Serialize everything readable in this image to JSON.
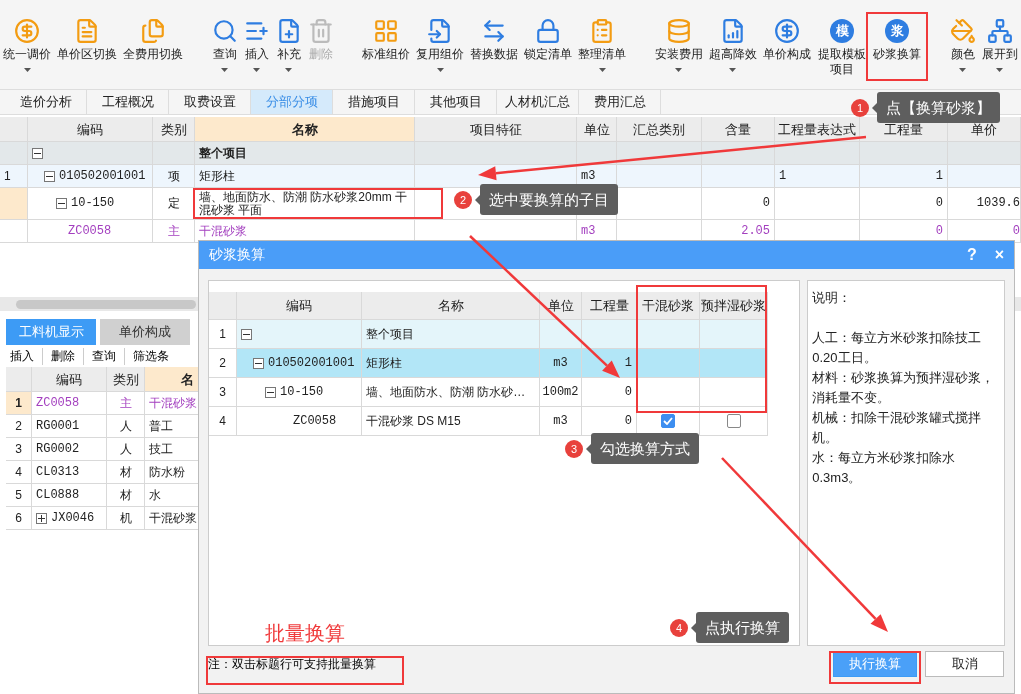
{
  "toolbar": {
    "groups": [
      {
        "items": [
          {
            "label": "统一调价",
            "has_menu": true,
            "disabled": false
          },
          {
            "label": "单价区切换",
            "has_menu": false,
            "disabled": false
          },
          {
            "label": "全费用切换",
            "has_menu": false,
            "disabled": false
          }
        ]
      },
      {
        "items": [
          {
            "label": "查询",
            "has_menu": true,
            "disabled": false
          },
          {
            "label": "插入",
            "has_menu": true,
            "disabled": false
          },
          {
            "label": "补充",
            "has_menu": true,
            "disabled": false
          },
          {
            "label": "删除",
            "has_menu": false,
            "disabled": true
          }
        ]
      },
      {
        "items": [
          {
            "label": "标准组价",
            "has_menu": false,
            "disabled": false
          },
          {
            "label": "复用组价",
            "has_menu": true,
            "disabled": false
          },
          {
            "label": "替换数据",
            "has_menu": false,
            "disabled": false
          },
          {
            "label": "锁定清单",
            "has_menu": false,
            "disabled": false
          },
          {
            "label": "整理清单",
            "has_menu": true,
            "disabled": false
          }
        ]
      },
      {
        "items": [
          {
            "label": "安装费用",
            "has_menu": true,
            "disabled": false
          },
          {
            "label": "超高降效",
            "has_menu": true,
            "disabled": false
          },
          {
            "label": "单价构成",
            "has_menu": false,
            "disabled": false
          },
          {
            "label": "提取模板项目",
            "badge": "模",
            "has_menu": false,
            "wrap": true,
            "disabled": false
          },
          {
            "label": "砂浆换算",
            "badge": "浆",
            "has_menu": false,
            "disabled": false
          }
        ]
      },
      {
        "items": [
          {
            "label": "颜色",
            "has_menu": true,
            "disabled": false
          },
          {
            "label": "展开到",
            "has_menu": true,
            "disabled": false
          }
        ]
      }
    ]
  },
  "tabs": [
    {
      "label": "造价分析",
      "selected": false
    },
    {
      "label": "工程概况",
      "selected": false
    },
    {
      "label": "取费设置",
      "selected": false
    },
    {
      "label": "分部分项",
      "selected": true
    },
    {
      "label": "措施项目",
      "selected": false
    },
    {
      "label": "其他项目",
      "selected": false
    },
    {
      "label": "人材机汇总",
      "selected": false
    },
    {
      "label": "费用汇总",
      "selected": false
    }
  ],
  "top_table": {
    "columns": [
      {
        "label": "编码",
        "selected": false
      },
      {
        "label": "类别",
        "selected": false
      },
      {
        "label": "名称",
        "selected": true
      },
      {
        "label": "项目特征",
        "selected": false
      },
      {
        "label": "单位",
        "selected": false
      },
      {
        "label": "汇总类别",
        "selected": false
      },
      {
        "label": "含量",
        "selected": false
      },
      {
        "label": "工程量表达式",
        "selected": false
      },
      {
        "label": "工程量",
        "selected": false
      },
      {
        "label": "单价",
        "selected": false
      }
    ],
    "rows": [
      {
        "kind": "group",
        "name": "整个项目",
        "expanded": true,
        "selected": false,
        "children": [
          {
            "kind": "item",
            "number": "1",
            "code": "010502001001",
            "category": "项",
            "name": "矩形柱",
            "unit": "m3",
            "expression": "1",
            "quantity": "1",
            "expanded": true,
            "selected": false,
            "children": [
              {
                "kind": "quota",
                "code": "10-150",
                "category": "定",
                "name": "墙、地面防水、防潮 防水砂浆20mm 干混砂浆 平面",
                "content": "0",
                "quantity": "0",
                "price": "1039.6",
                "expanded": true,
                "selected": true,
                "children": [
                  {
                    "kind": "material",
                    "code": "ZC0058",
                    "category": "主",
                    "name": "干混砂浆",
                    "unit": "m3",
                    "content": "2.05",
                    "quantity": "0",
                    "price": "0",
                    "selected": false
                  }
                ]
              }
            ]
          }
        ]
      }
    ]
  },
  "detail_panel": {
    "tabs": [
      {
        "label": "工料机显示",
        "selected": true
      },
      {
        "label": "单价构成",
        "selected": false
      }
    ],
    "actions": [
      "插入",
      "删除",
      "查询",
      "筛选条"
    ],
    "columns": [
      {
        "label": "编码",
        "selected": false
      },
      {
        "label": "类别",
        "selected": false
      },
      {
        "label": "名",
        "selected": true
      }
    ],
    "rows": [
      {
        "kind": "material",
        "number": "1",
        "code": "ZC0058",
        "category": "主",
        "name": "干混砂浆",
        "selected": true
      },
      {
        "kind": "labor",
        "number": "2",
        "code": "RG0001",
        "category": "人",
        "name": "普工",
        "selected": false
      },
      {
        "kind": "labor",
        "number": "3",
        "code": "RG0002",
        "category": "人",
        "name": "技工",
        "selected": false
      },
      {
        "kind": "labor",
        "number": "4",
        "code": "CL0313",
        "category": "材",
        "name": "防水粉",
        "selected": false
      },
      {
        "kind": "labor",
        "number": "5",
        "code": "CL0888",
        "category": "材",
        "name": "水",
        "selected": false
      },
      {
        "kind": "machine",
        "number": "6",
        "code": "JX0046",
        "category": "机",
        "name": "干混砂浆",
        "expanded": false,
        "selected": false
      }
    ]
  },
  "dialog": {
    "title": "砂浆换算",
    "help": "?",
    "close": "×",
    "columns": [
      "编码",
      "名称",
      "单位",
      "工程量",
      "干混砂浆",
      "预拌湿砂浆"
    ],
    "rows": [
      {
        "kind": "group",
        "number": "1",
        "name": "整个项目",
        "expanded": true,
        "selected": false,
        "children": [
          {
            "kind": "item",
            "number": "2",
            "code": "010502001001",
            "name": "矩形柱",
            "unit": "m3",
            "quantity": "1",
            "expanded": true,
            "selected": true,
            "children": [
              {
                "kind": "quota",
                "number": "3",
                "code": "10-150",
                "name": "墙、地面防水、防潮 防水砂…",
                "unit": "100m2",
                "quantity": "0",
                "expanded": true,
                "selected": false,
                "children": [
                  {
                    "kind": "material",
                    "number": "4",
                    "code": "ZC0058",
                    "name": "干混砂浆 DS M15",
                    "unit": "m3",
                    "quantity": "0",
                    "dry_mix": true,
                    "wet_mix": false,
                    "selected": false
                  }
                ]
              }
            ]
          }
        ]
      }
    ],
    "description": [
      "说明：",
      "人工：每立方米砂浆扣除技工0.20工日。",
      "材料：砂浆换算为预拌湿砂浆，消耗量不变。",
      "机械：扣除干混砂浆罐式搅拌机。",
      "水：每立方米砂浆扣除水0.3m3。"
    ],
    "note": "注：双击标题行可支持批量换算",
    "buttons": [
      {
        "label": "执行换算",
        "primary": true
      },
      {
        "label": "取消",
        "primary": false
      }
    ]
  },
  "annotations": {
    "callouts": [
      {
        "number": "1",
        "text": "点【换算砂浆】"
      },
      {
        "number": "2",
        "text": "选中要换算的子目"
      },
      {
        "number": "3",
        "text": "勾选换算方式"
      },
      {
        "number": "4",
        "text": "点执行换算"
      }
    ],
    "caption": "批量换算"
  }
}
